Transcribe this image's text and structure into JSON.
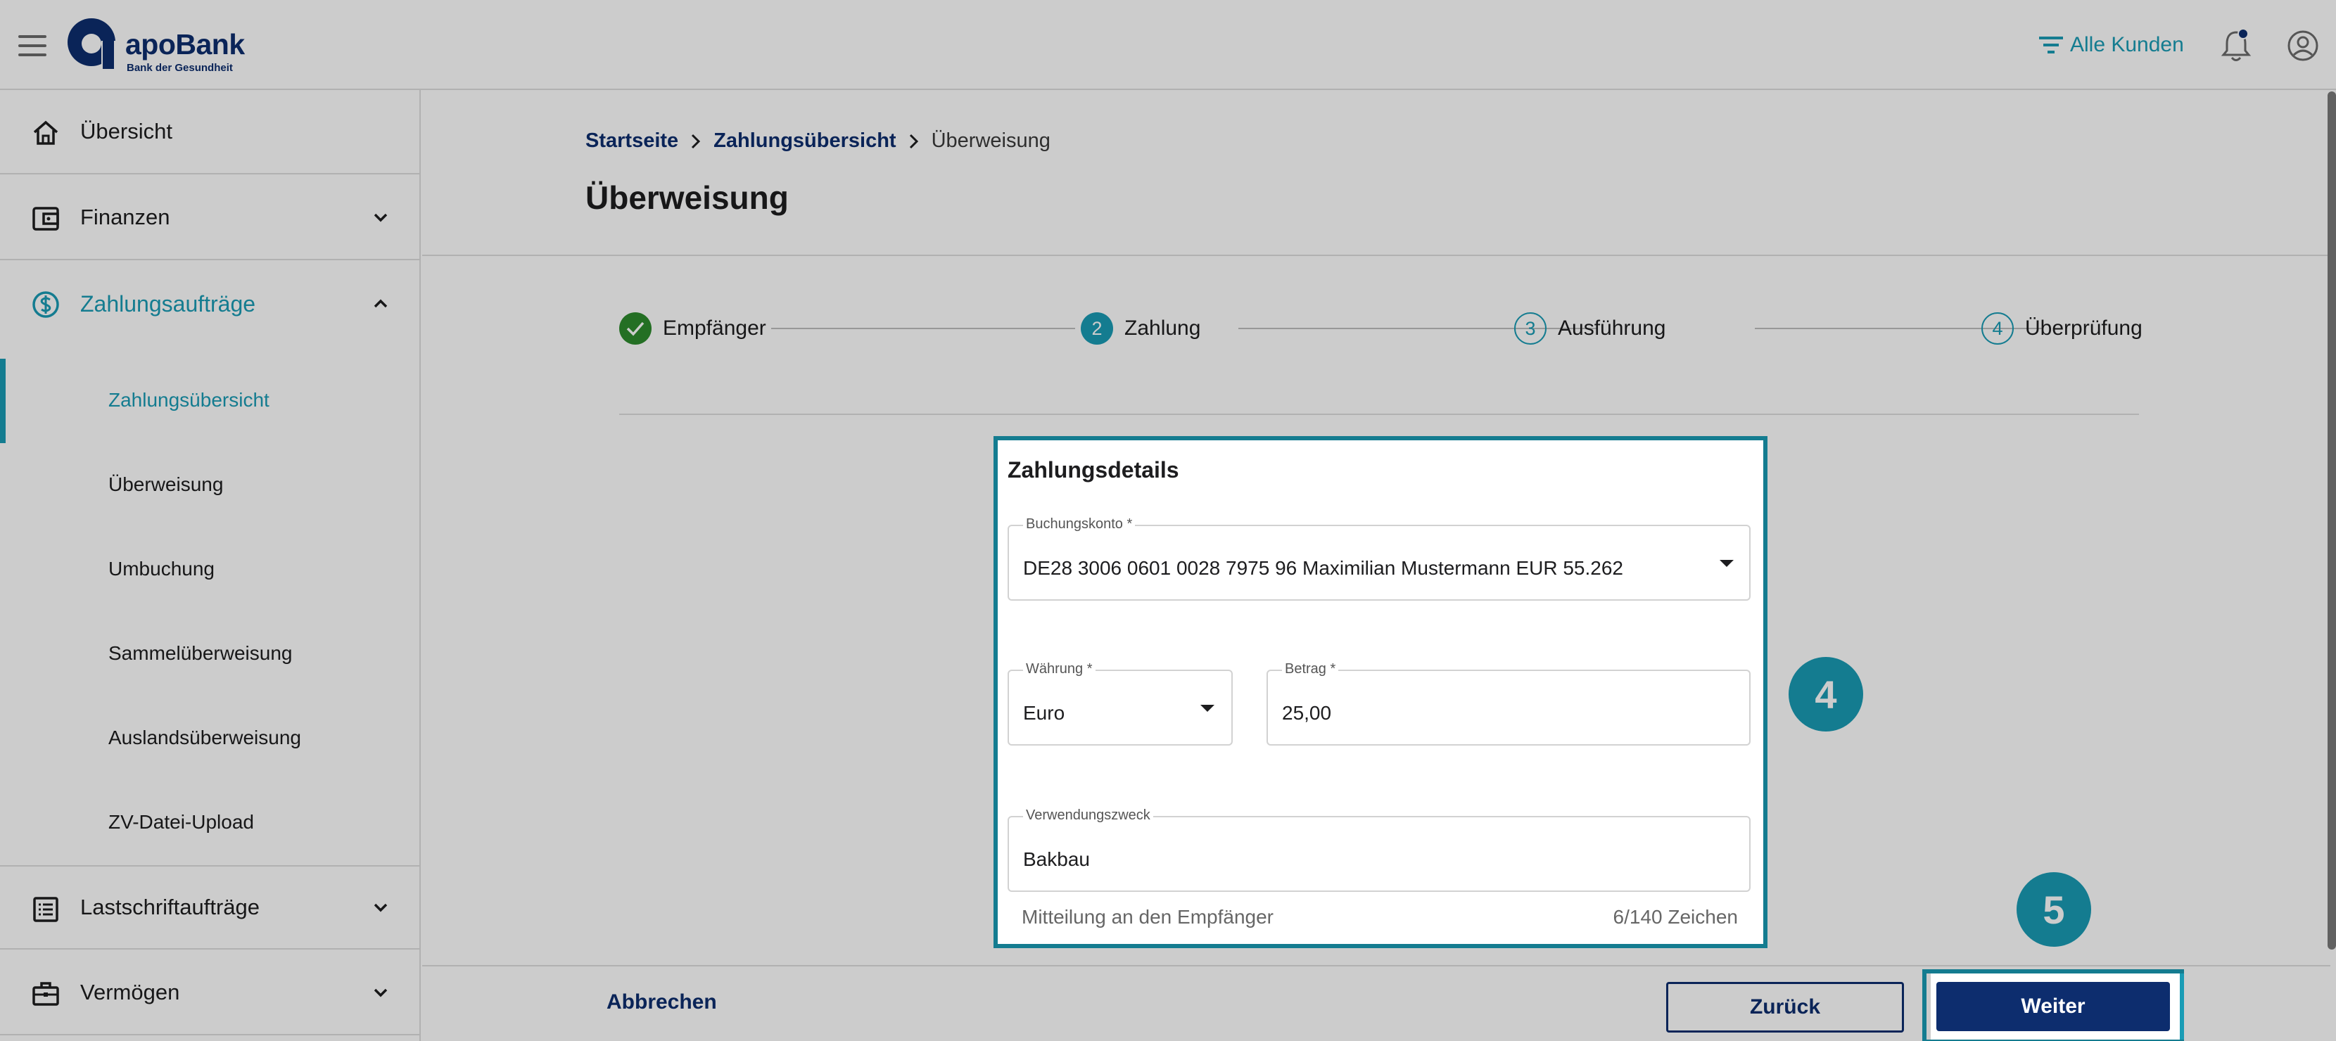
{
  "header": {
    "brand_name": "apoBank",
    "brand_tagline": "Bank der Gesundheit",
    "filter_label": "Alle Kunden"
  },
  "sidebar": {
    "items": [
      {
        "label": "Übersicht",
        "icon": "home-icon"
      },
      {
        "label": "Finanzen",
        "icon": "wallet-icon"
      },
      {
        "label": "Zahlungsaufträge",
        "icon": "dollar-circle-icon",
        "expanded": true
      },
      {
        "label": "Lastschriftaufträge",
        "icon": "list-icon"
      },
      {
        "label": "Vermögen",
        "icon": "briefcase-icon"
      }
    ],
    "sub_items": [
      {
        "label": "Zahlungsübersicht",
        "active": true
      },
      {
        "label": "Überweisung"
      },
      {
        "label": "Umbuchung"
      },
      {
        "label": "Sammelüberweisung"
      },
      {
        "label": "Auslandsüberweisung"
      },
      {
        "label": "ZV-Datei-Upload"
      }
    ]
  },
  "breadcrumb": {
    "items": [
      "Startseite",
      "Zahlungsübersicht",
      "Überweisung"
    ]
  },
  "page": {
    "title": "Überweisung"
  },
  "stepper": {
    "steps": [
      {
        "number": "",
        "label": "Empfänger",
        "state": "done"
      },
      {
        "number": "2",
        "label": "Zahlung",
        "state": "active"
      },
      {
        "number": "3",
        "label": "Ausführung",
        "state": "pending"
      },
      {
        "number": "4",
        "label": "Überprüfung",
        "state": "pending"
      }
    ]
  },
  "form": {
    "title": "Zahlungsdetails",
    "account": {
      "label": "Buchungskonto *",
      "value": "DE28 3006 0601 0028 7975 96 Maximilian Mustermann EUR 55.262"
    },
    "currency": {
      "label": "Währung *",
      "value": "Euro"
    },
    "amount": {
      "label": "Betrag *",
      "value": "25,00"
    },
    "purpose": {
      "label": "Verwendungszweck",
      "value": "Bakbau",
      "helper": "Mitteilung an den Empfänger",
      "counter": "6/140 Zeichen"
    }
  },
  "markers": {
    "form": "4",
    "next": "5"
  },
  "footer": {
    "cancel": "Abbrechen",
    "back": "Zurück",
    "next": "Weiter"
  },
  "colors": {
    "accent": "#1a9cb5",
    "primary": "#0d2d6e",
    "success": "#2e8b2e"
  }
}
